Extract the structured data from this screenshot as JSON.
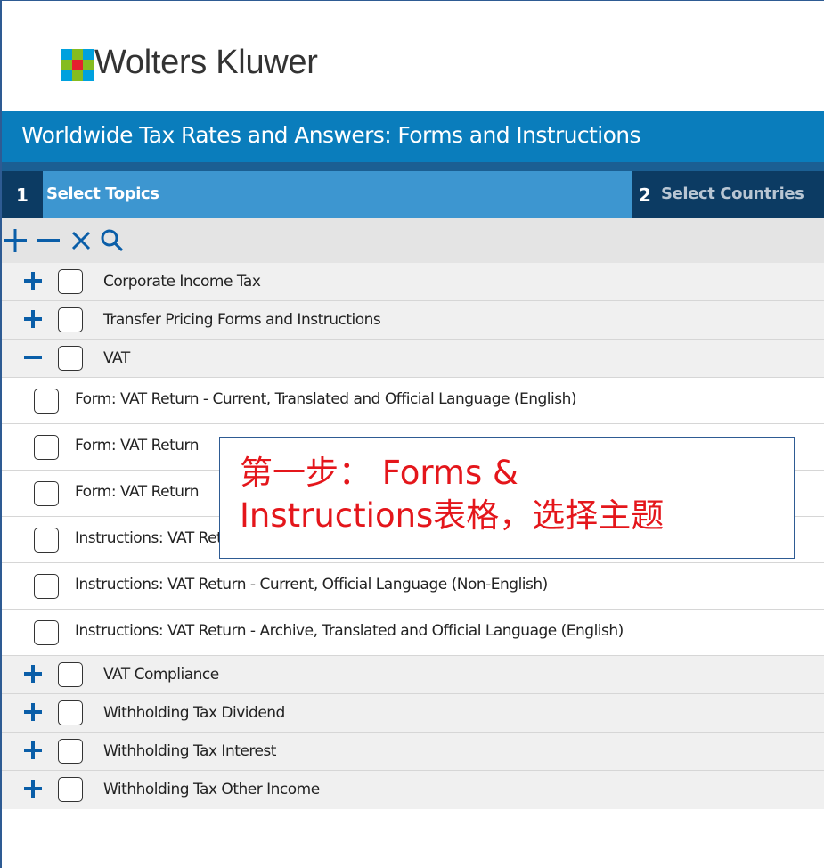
{
  "brand": {
    "name": "Wolters Kluwer",
    "logo_icon": "wolters-kluwer-globe-logo"
  },
  "title_bar": {
    "title": "Worldwide Tax Rates and Answers: Forms and Instructions"
  },
  "steps": [
    {
      "number": "1",
      "label": "Select Topics",
      "active": true
    },
    {
      "number": "2",
      "label": "Select Countries",
      "active": false
    }
  ],
  "toolbar": {
    "buttons": [
      {
        "name": "expand-all",
        "icon": "plus-icon"
      },
      {
        "name": "collapse-all",
        "icon": "minus-icon"
      },
      {
        "name": "clear-all",
        "icon": "close-icon"
      },
      {
        "name": "search",
        "icon": "search-icon"
      }
    ]
  },
  "tree": {
    "top_items": [
      {
        "label": "Corporate Income Tax",
        "expanded": false,
        "checked": false
      },
      {
        "label": "Transfer Pricing Forms and Instructions",
        "expanded": false,
        "checked": false
      },
      {
        "label": "VAT",
        "expanded": true,
        "checked": false
      }
    ],
    "vat_children": [
      {
        "label": "Form: VAT Return - Current, Translated and Official Language (English)",
        "checked": false
      },
      {
        "label": "Form: VAT Return",
        "checked": false
      },
      {
        "label": "Form: VAT Return",
        "checked": false
      },
      {
        "label": "Instructions: VAT Return - Current, Translated and Official Language (English)",
        "checked": false
      },
      {
        "label": "Instructions: VAT Return - Current, Official Language (Non-English)",
        "checked": false
      },
      {
        "label": "Instructions: VAT Return - Archive, Translated and Official Language (English)",
        "checked": false
      }
    ],
    "bottom_items": [
      {
        "label": "VAT Compliance",
        "expanded": false,
        "checked": false
      },
      {
        "label": "Withholding Tax Dividend",
        "expanded": false,
        "checked": false
      },
      {
        "label": "Withholding Tax Interest",
        "expanded": false,
        "checked": false
      },
      {
        "label": "Withholding Tax Other Income",
        "expanded": false,
        "checked": false
      }
    ]
  },
  "annotation": {
    "line1": "第一步： Forms &",
    "line2": "Instructions表格，选择主题",
    "color": "#e4161b"
  },
  "colors": {
    "title_bar": "#0a7dbc",
    "step_active": "#3d96d0",
    "step_dark": "#0c3b63",
    "icon_blue": "#0a5ea8",
    "toolbar_bg": "#e4e4e4"
  }
}
